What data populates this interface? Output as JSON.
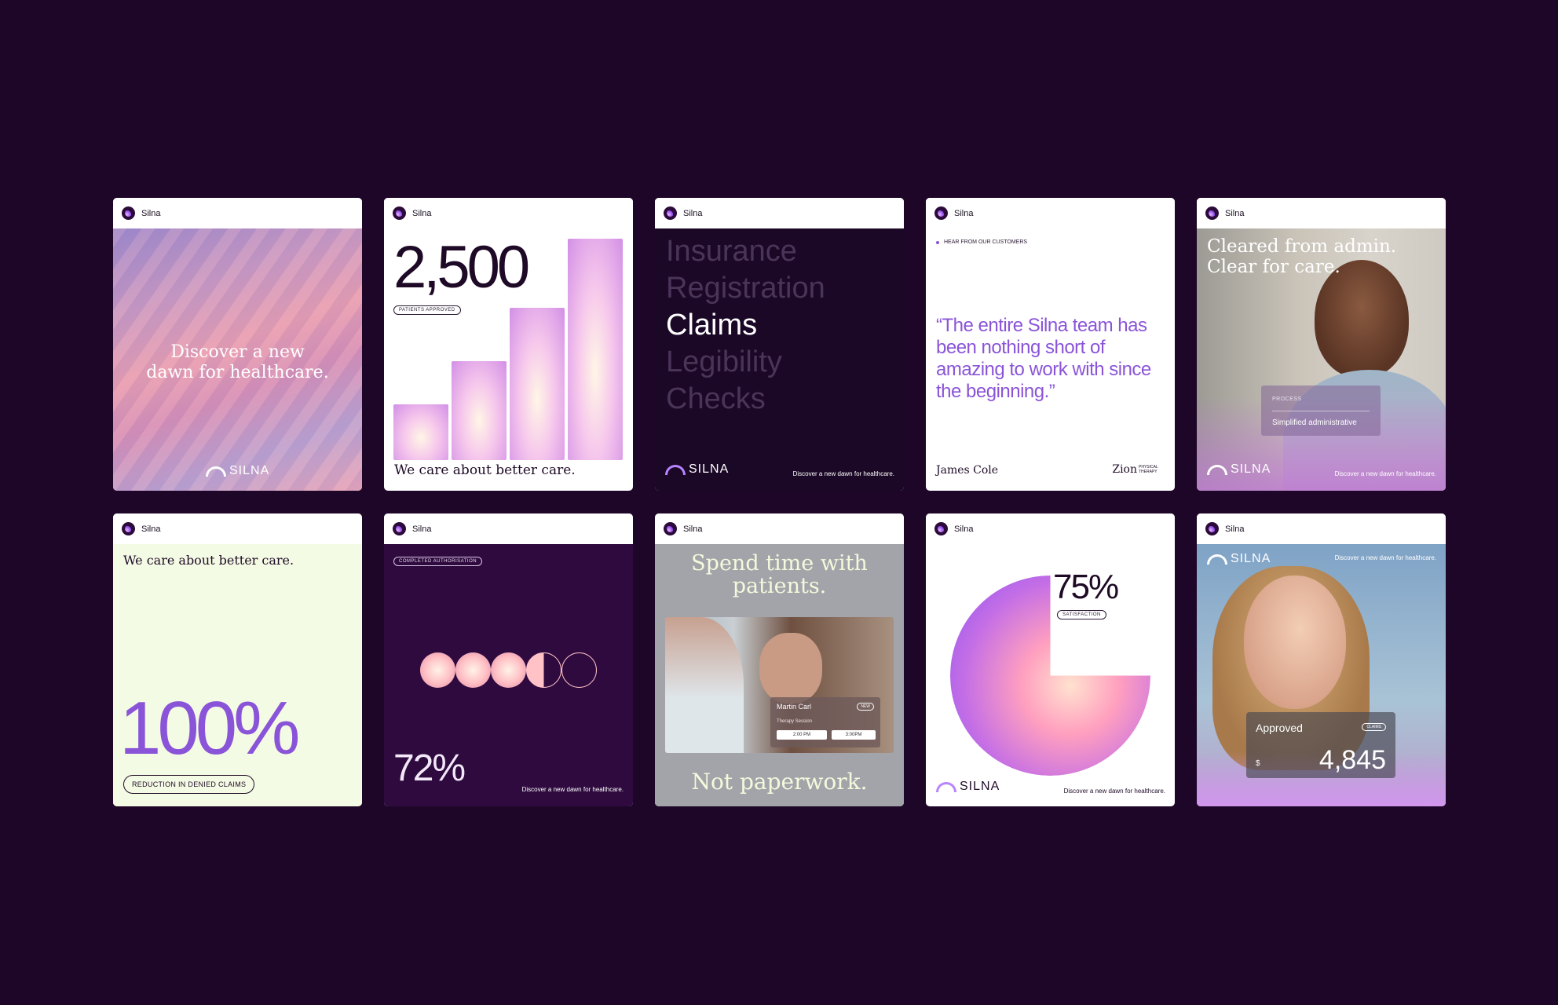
{
  "brand": {
    "name": "Silna",
    "wordmark": "SILNA",
    "tagline": "Discover a new dawn for healthcare."
  },
  "cards": {
    "c1": {
      "headline": "Discover a new dawn for healthcare."
    },
    "c2": {
      "number": "2,500",
      "pill": "PATIENTS APPROVED",
      "caption": "We care about better care.",
      "bars": [
        0.21,
        0.37,
        0.57,
        0.83
      ]
    },
    "c3": {
      "words": [
        "Insurance",
        "Registration",
        "Claims",
        "Legibility",
        "Checks"
      ],
      "active_index": 2
    },
    "c4": {
      "eyebrow": "HEAR FROM OUR CUSTOMERS",
      "quote": "“The entire Silna team has been nothing short of amazing to work with since the beginning.”",
      "author": "James Cole",
      "company": "Zion",
      "company_sub": "PHYSICAL THERAPY"
    },
    "c5": {
      "headline": "Cleared from admin. Clear for care.",
      "process_label": "PROCESS",
      "process_value": "Simplified administrative"
    },
    "c6": {
      "caption": "We care about better care.",
      "number": "100%",
      "pill": "REDUCTION IN DENIED CLAIMS"
    },
    "c7": {
      "pill": "COMPLETED AUTHORISATION",
      "number": "72%",
      "percent": 72
    },
    "c8": {
      "headline": "Spend time with patients.",
      "footer": "Not paperwork.",
      "patient": "Martin Carl",
      "badge": "NEW",
      "session": "Therapy Session",
      "times": [
        "2:00 PM",
        "3:00PM"
      ]
    },
    "c9": {
      "number": "75%",
      "pill": "SATISFACTION",
      "percent": 75
    },
    "c10": {
      "status": "Approved",
      "badge": "CLAIMS",
      "currency": "$",
      "amount": "4,845"
    }
  },
  "colors": {
    "background": "#1e0628",
    "plum": "#2e0a3e",
    "lavender": "#8a54d8",
    "mint": "#f4fbe4"
  }
}
